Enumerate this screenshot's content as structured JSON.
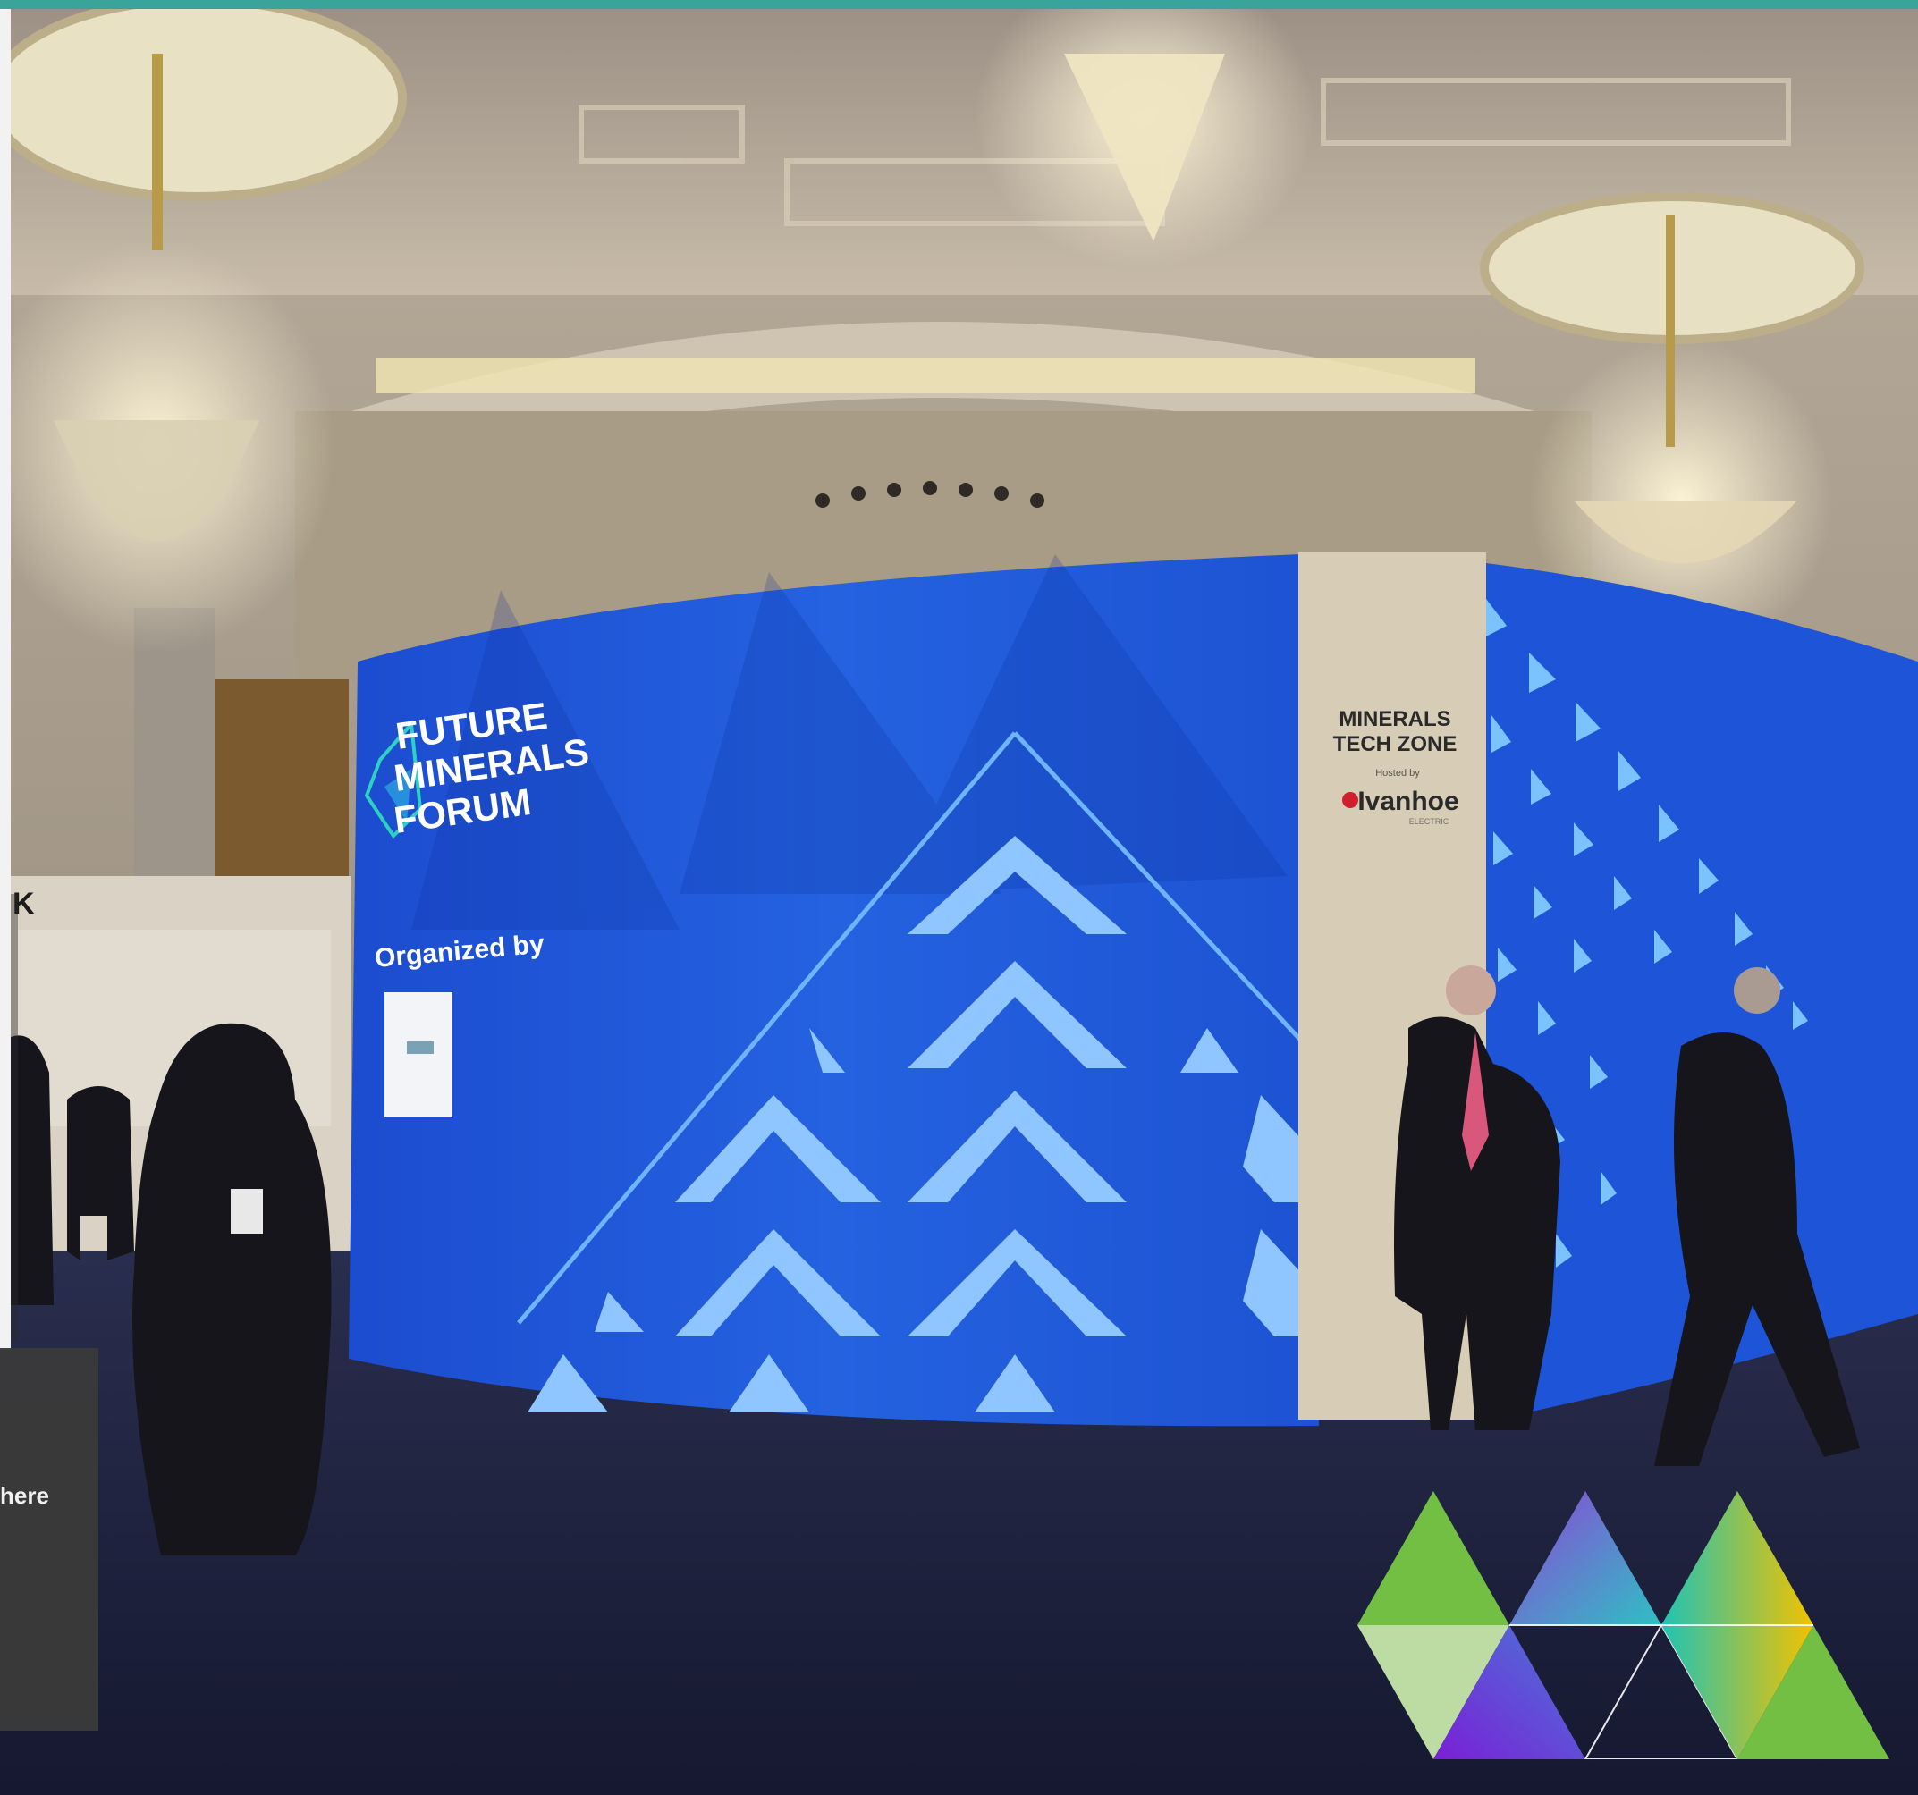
{
  "colors": {
    "top_strip": "#3aa39a",
    "card_bg": "#3a3a3a",
    "screen_blue": "#1f55d6"
  },
  "hero_photo": {
    "ticker_letter": "K",
    "ticker_letter_2": "here",
    "screen": {
      "logo_lines": [
        "FUTURE",
        "MINERALS",
        "FORUM"
      ],
      "organized_by": "Organized by"
    },
    "pillar": {
      "title_line1": "MINERALS",
      "title_line2": "TECH ZONE",
      "hosted_by": "Hosted by",
      "sponsor": "Ivanhoe",
      "sponsor_sub": "ELECTRIC"
    }
  },
  "overlay_card": {
    "text": "here"
  },
  "icons": {
    "corner_logo": "triangle-mosaic-logo-icon",
    "forum_logo": "diamond-logo-icon"
  }
}
